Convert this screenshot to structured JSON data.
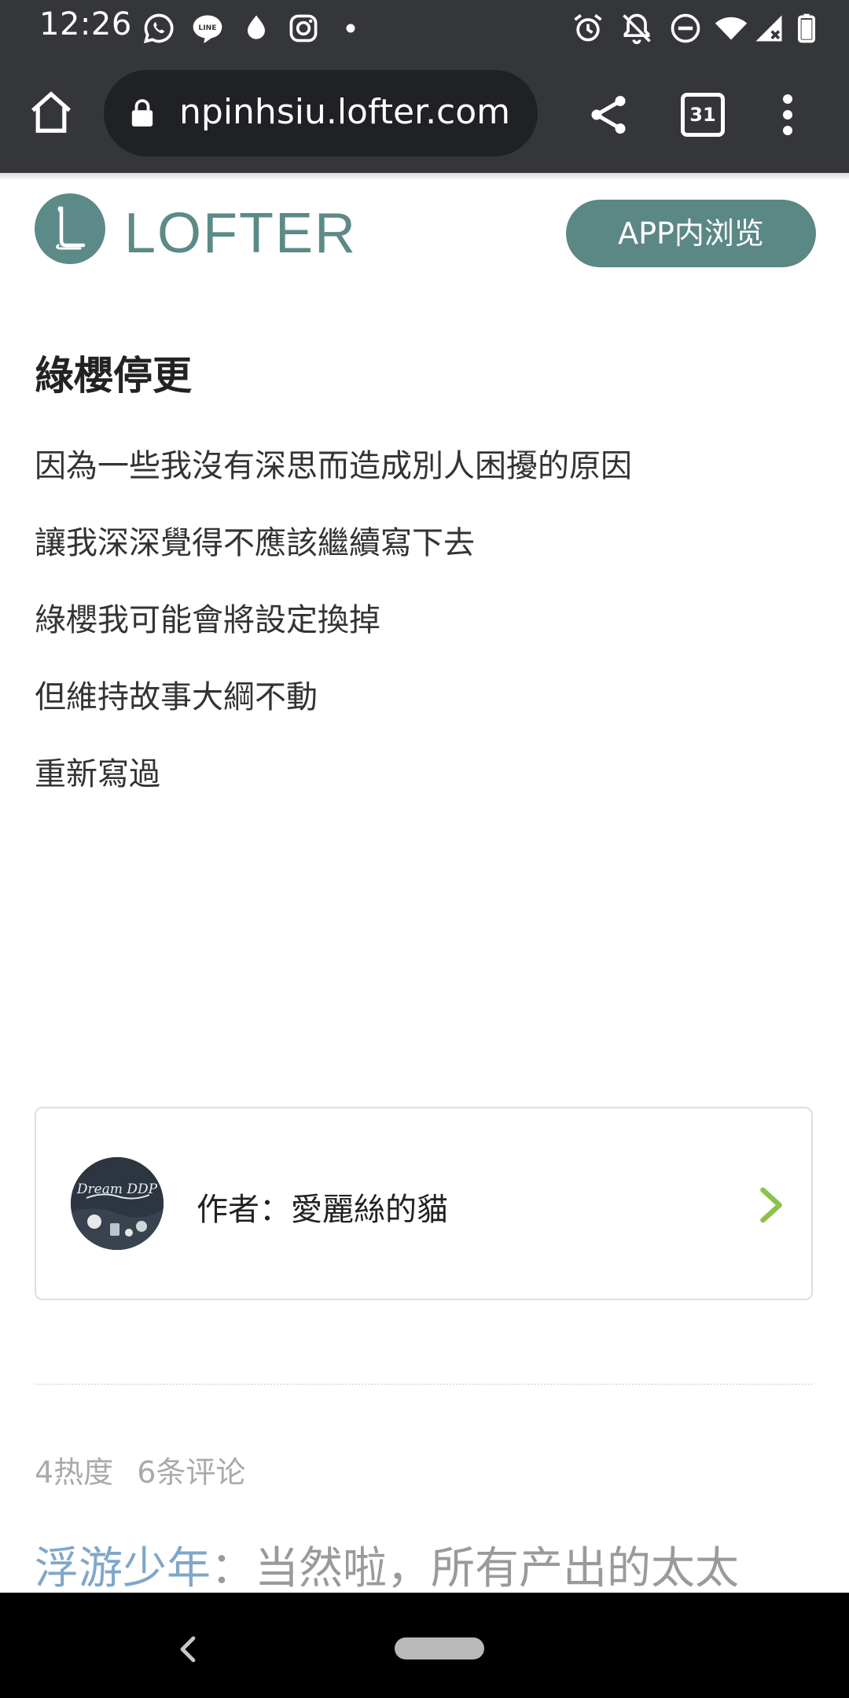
{
  "status_bar": {
    "time": "12:26",
    "left_icons": [
      "whatsapp-icon",
      "line-icon",
      "drop-icon",
      "instagram-icon",
      "dot-icon"
    ],
    "right_icons": [
      "alarm-icon",
      "notifications-off-icon",
      "dnd-icon",
      "wifi-icon",
      "signal-icon",
      "battery-icon"
    ]
  },
  "browser": {
    "url": "npinhsiu.lofter.com",
    "tab_count": "31"
  },
  "header": {
    "logo_text": "LOFTER",
    "app_button": "APP内浏览"
  },
  "post": {
    "title": "綠櫻停更",
    "lines": [
      "因為一些我沒有深思而造成別人困擾的原因",
      "讓我深深覺得不應該繼續寫下去",
      "綠櫻我可能會將設定換掉",
      "但維持故事大綱不動",
      "重新寫過"
    ]
  },
  "author": {
    "label": "作者：愛麗絲的貓",
    "avatar_text": "Dream DDP"
  },
  "stats": {
    "heat": "4热度",
    "comments": "6条评论"
  },
  "comment": {
    "commenter": "浮游少年",
    "text": "：当然啦，所有产出的太太"
  },
  "colors": {
    "toolbar_bg": "#35363a",
    "brand": "#5c8a89",
    "chevron": "#8bc34a",
    "commenter": "#7fa7c9"
  }
}
